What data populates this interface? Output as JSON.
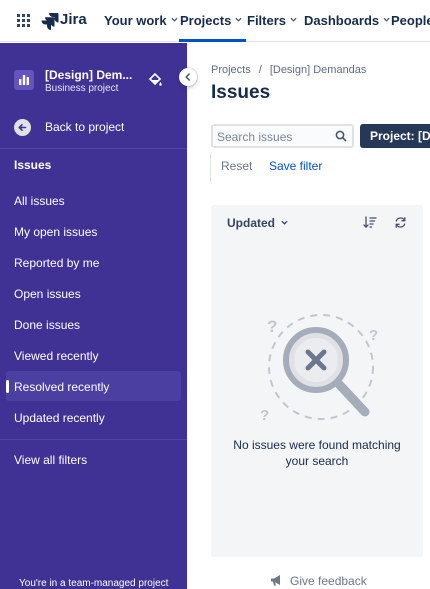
{
  "topnav": {
    "logo_text": "Jira",
    "items": [
      {
        "label": "Your work"
      },
      {
        "label": "Projects"
      },
      {
        "label": "Filters"
      },
      {
        "label": "Dashboards"
      },
      {
        "label": "People"
      }
    ],
    "active": "Projects",
    "accent_color": "#0052cc"
  },
  "sidebar": {
    "project_name": "[Design] Dem...",
    "project_type": "Business project",
    "back_label": "Back to project",
    "heading": "Issues",
    "items": [
      {
        "label": "All issues"
      },
      {
        "label": "My open issues"
      },
      {
        "label": "Reported by me"
      },
      {
        "label": "Open issues"
      },
      {
        "label": "Done issues"
      },
      {
        "label": "Viewed recently"
      },
      {
        "label": "Resolved recently"
      },
      {
        "label": "Updated recently"
      }
    ],
    "selected": "Resolved recently",
    "view_all_label": "View all filters",
    "footer": "You're in a team-managed project",
    "bg_color": "#403294"
  },
  "main": {
    "breadcrumb": [
      "Projects",
      "[Design] Demandas"
    ],
    "title": "Issues",
    "search": {
      "placeholder": "Search issues",
      "value": ""
    },
    "project_button": "Project: [Design] Demandas",
    "reset_label": "Reset",
    "save_filter_label": "Save filter",
    "sort_label": "Updated",
    "empty_message": "No issues were found matching your search",
    "feedback_label": "Give feedback"
  }
}
